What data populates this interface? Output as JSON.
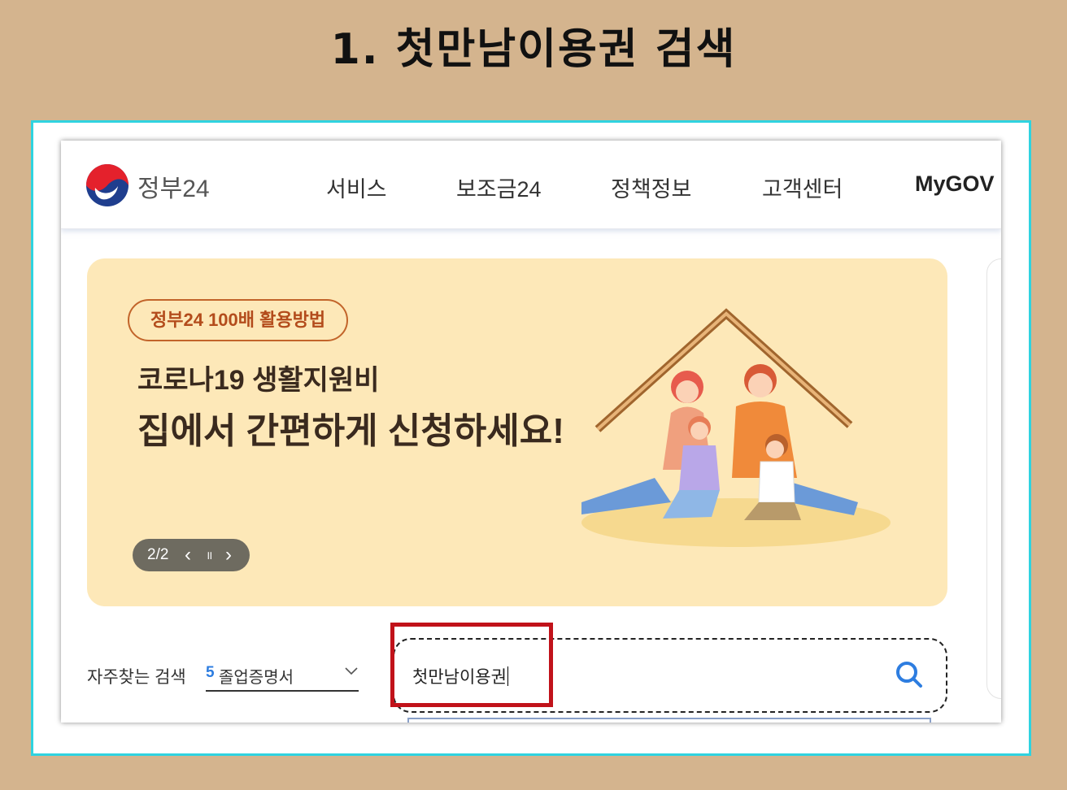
{
  "slide": {
    "title": "1. 첫만남이용권 검색"
  },
  "header": {
    "brand": "정부24",
    "nav": [
      "서비스",
      "보조금24",
      "정책정보",
      "고객센터",
      "MyGOV"
    ]
  },
  "banner": {
    "pill": "정부24 100배 활용방법",
    "subtitle": "코로나19 생활지원비",
    "headline": "집에서 간편하게 신청하세요!",
    "pager": {
      "current": "2/2",
      "prev": "‹",
      "pause": "॥",
      "next": "›"
    }
  },
  "search": {
    "frequent_label": "자주찾는 검색",
    "frequent_rank": "5",
    "frequent_item": "졸업증명서",
    "query": "첫만남이용권"
  },
  "colors": {
    "page_bg": "#d4b48e",
    "frame_border": "#2fd3e0",
    "banner_bg": "#fde8b8",
    "highlight": "#c1121a",
    "accent_blue": "#2d7de0"
  }
}
